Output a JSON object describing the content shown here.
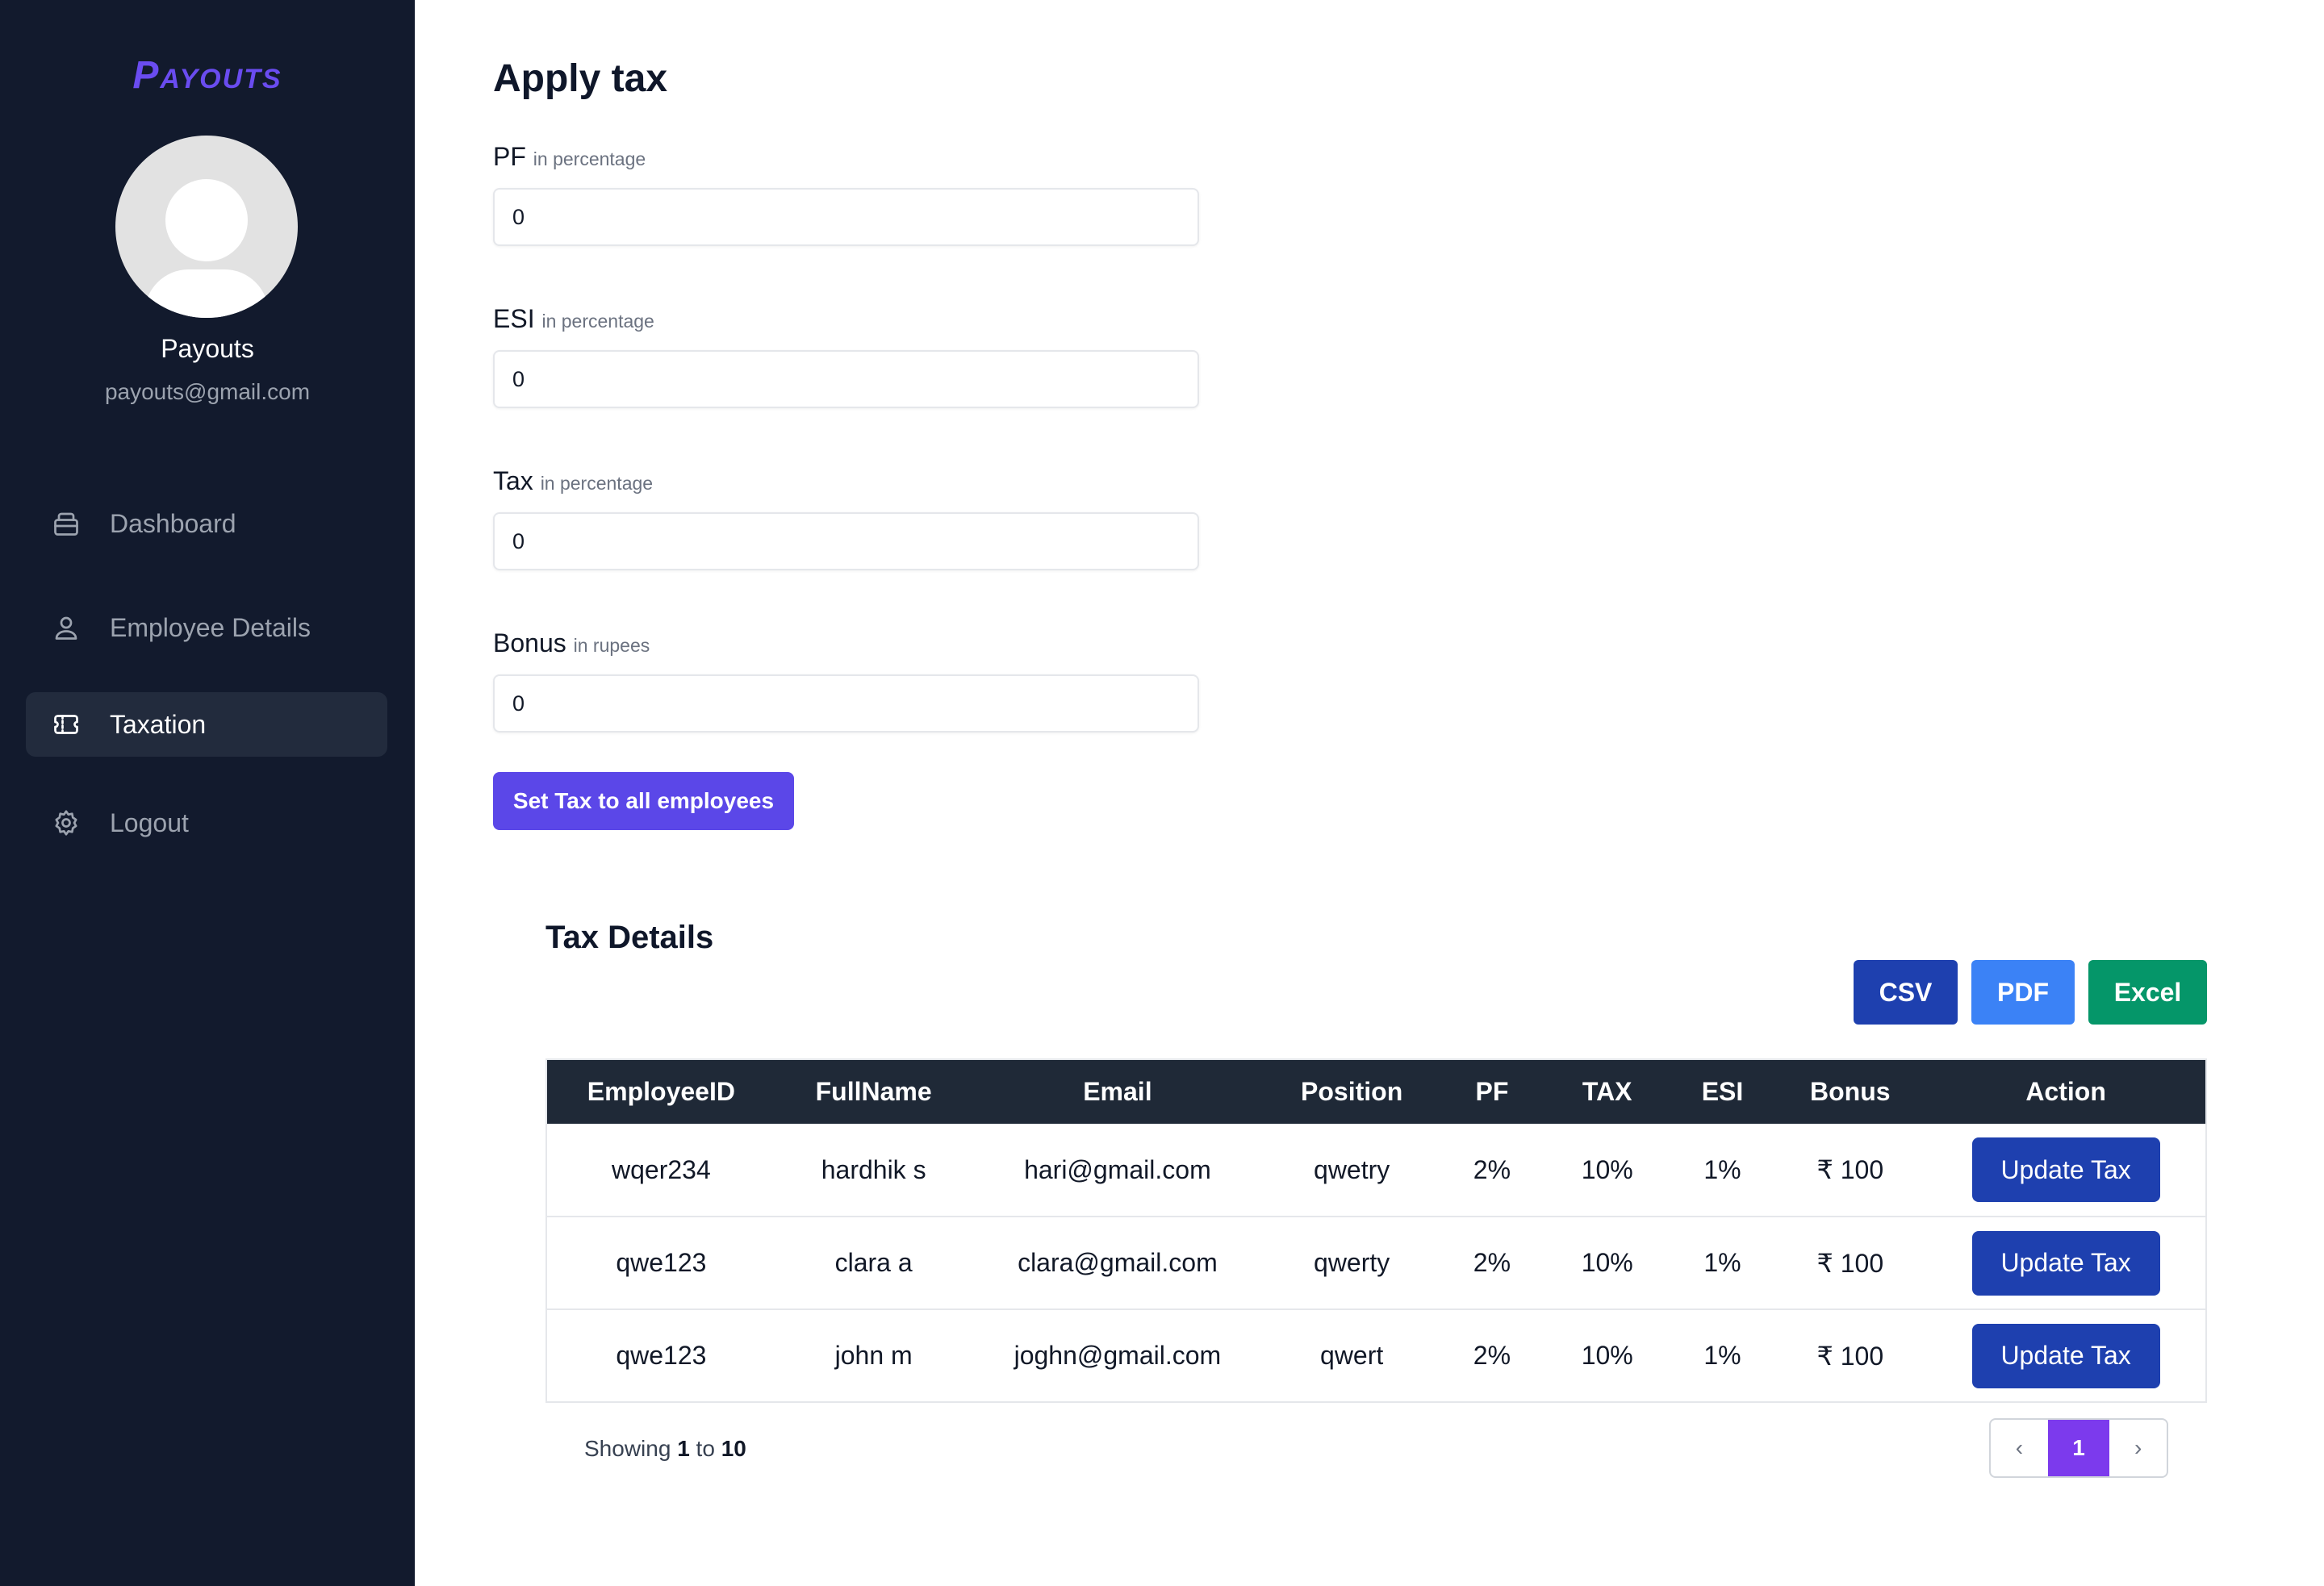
{
  "brand": {
    "logo_first": "P",
    "logo_rest": "AYOUTS"
  },
  "user": {
    "name": "Payouts",
    "email": "payouts@gmail.com"
  },
  "sidebar": {
    "items": [
      {
        "label": "Dashboard",
        "icon": "wallet-icon"
      },
      {
        "label": "Employee Details",
        "icon": "user-icon"
      },
      {
        "label": "Taxation",
        "icon": "ticket-icon",
        "active": true
      },
      {
        "label": "Logout",
        "icon": "gear-icon"
      }
    ]
  },
  "form": {
    "title": "Apply tax",
    "fields": [
      {
        "label": "PF",
        "hint": "in percentage",
        "value": "0"
      },
      {
        "label": "ESI",
        "hint": "in percentage",
        "value": "0"
      },
      {
        "label": "Tax",
        "hint": "in percentage",
        "value": "0"
      },
      {
        "label": "Bonus",
        "hint": "in rupees",
        "value": "0"
      }
    ],
    "submit_label": "Set Tax to all employees"
  },
  "details": {
    "title": "Tax Details",
    "export": {
      "csv": "CSV",
      "pdf": "PDF",
      "excel": "Excel"
    },
    "columns": [
      "EmployeeID",
      "FullName",
      "Email",
      "Position",
      "PF",
      "TAX",
      "ESI",
      "Bonus",
      "Action"
    ],
    "rows": [
      {
        "id": "wqer234",
        "name": "hardhik s",
        "email": "hari@gmail.com",
        "position": "qwetry",
        "pf": "2%",
        "tax": "10%",
        "esi": "1%",
        "bonus": "₹ 100",
        "action": "Update Tax"
      },
      {
        "id": "qwe123",
        "name": "clara a",
        "email": "clara@gmail.com",
        "position": "qwerty",
        "pf": "2%",
        "tax": "10%",
        "esi": "1%",
        "bonus": "₹ 100",
        "action": "Update Tax"
      },
      {
        "id": "qwe123",
        "name": "john m",
        "email": "joghn@gmail.com",
        "position": "qwert",
        "pf": "2%",
        "tax": "10%",
        "esi": "1%",
        "bonus": "₹ 100",
        "action": "Update Tax"
      }
    ]
  },
  "pagination": {
    "showing_prefix": "Showing",
    "from": "1",
    "to_word": "to",
    "to": "10",
    "current_page": "1",
    "prev": "‹",
    "next": "›"
  },
  "colors": {
    "sidebar_bg": "#121a2d",
    "accent": "#5b47e8",
    "table_header": "#1f2937",
    "update_button": "#1e40af",
    "csv": "#1e40af",
    "pdf": "#3b82f6",
    "excel": "#059669",
    "page_current": "#7c3aed"
  }
}
